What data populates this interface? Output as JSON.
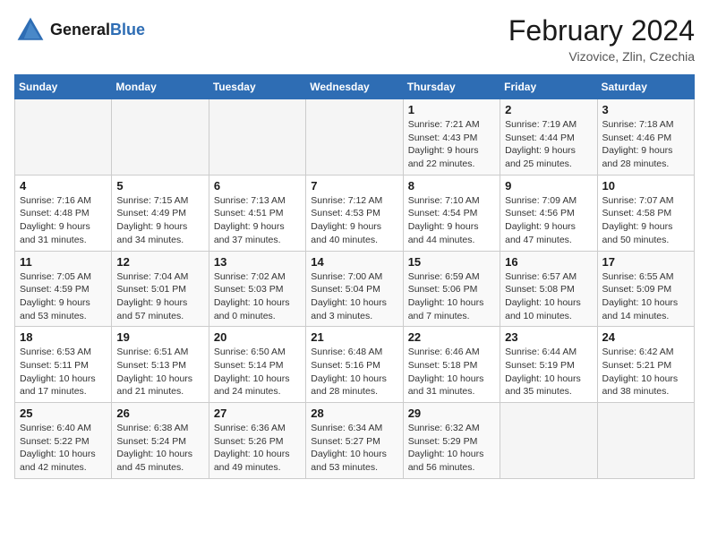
{
  "logo": {
    "text_general": "General",
    "text_blue": "Blue"
  },
  "title": {
    "month_year": "February 2024",
    "location": "Vizovice, Zlin, Czechia"
  },
  "weekdays": [
    "Sunday",
    "Monday",
    "Tuesday",
    "Wednesday",
    "Thursday",
    "Friday",
    "Saturday"
  ],
  "weeks": [
    [
      {
        "day": "",
        "info": ""
      },
      {
        "day": "",
        "info": ""
      },
      {
        "day": "",
        "info": ""
      },
      {
        "day": "",
        "info": ""
      },
      {
        "day": "1",
        "info": "Sunrise: 7:21 AM\nSunset: 4:43 PM\nDaylight: 9 hours\nand 22 minutes."
      },
      {
        "day": "2",
        "info": "Sunrise: 7:19 AM\nSunset: 4:44 PM\nDaylight: 9 hours\nand 25 minutes."
      },
      {
        "day": "3",
        "info": "Sunrise: 7:18 AM\nSunset: 4:46 PM\nDaylight: 9 hours\nand 28 minutes."
      }
    ],
    [
      {
        "day": "4",
        "info": "Sunrise: 7:16 AM\nSunset: 4:48 PM\nDaylight: 9 hours\nand 31 minutes."
      },
      {
        "day": "5",
        "info": "Sunrise: 7:15 AM\nSunset: 4:49 PM\nDaylight: 9 hours\nand 34 minutes."
      },
      {
        "day": "6",
        "info": "Sunrise: 7:13 AM\nSunset: 4:51 PM\nDaylight: 9 hours\nand 37 minutes."
      },
      {
        "day": "7",
        "info": "Sunrise: 7:12 AM\nSunset: 4:53 PM\nDaylight: 9 hours\nand 40 minutes."
      },
      {
        "day": "8",
        "info": "Sunrise: 7:10 AM\nSunset: 4:54 PM\nDaylight: 9 hours\nand 44 minutes."
      },
      {
        "day": "9",
        "info": "Sunrise: 7:09 AM\nSunset: 4:56 PM\nDaylight: 9 hours\nand 47 minutes."
      },
      {
        "day": "10",
        "info": "Sunrise: 7:07 AM\nSunset: 4:58 PM\nDaylight: 9 hours\nand 50 minutes."
      }
    ],
    [
      {
        "day": "11",
        "info": "Sunrise: 7:05 AM\nSunset: 4:59 PM\nDaylight: 9 hours\nand 53 minutes."
      },
      {
        "day": "12",
        "info": "Sunrise: 7:04 AM\nSunset: 5:01 PM\nDaylight: 9 hours\nand 57 minutes."
      },
      {
        "day": "13",
        "info": "Sunrise: 7:02 AM\nSunset: 5:03 PM\nDaylight: 10 hours\nand 0 minutes."
      },
      {
        "day": "14",
        "info": "Sunrise: 7:00 AM\nSunset: 5:04 PM\nDaylight: 10 hours\nand 3 minutes."
      },
      {
        "day": "15",
        "info": "Sunrise: 6:59 AM\nSunset: 5:06 PM\nDaylight: 10 hours\nand 7 minutes."
      },
      {
        "day": "16",
        "info": "Sunrise: 6:57 AM\nSunset: 5:08 PM\nDaylight: 10 hours\nand 10 minutes."
      },
      {
        "day": "17",
        "info": "Sunrise: 6:55 AM\nSunset: 5:09 PM\nDaylight: 10 hours\nand 14 minutes."
      }
    ],
    [
      {
        "day": "18",
        "info": "Sunrise: 6:53 AM\nSunset: 5:11 PM\nDaylight: 10 hours\nand 17 minutes."
      },
      {
        "day": "19",
        "info": "Sunrise: 6:51 AM\nSunset: 5:13 PM\nDaylight: 10 hours\nand 21 minutes."
      },
      {
        "day": "20",
        "info": "Sunrise: 6:50 AM\nSunset: 5:14 PM\nDaylight: 10 hours\nand 24 minutes."
      },
      {
        "day": "21",
        "info": "Sunrise: 6:48 AM\nSunset: 5:16 PM\nDaylight: 10 hours\nand 28 minutes."
      },
      {
        "day": "22",
        "info": "Sunrise: 6:46 AM\nSunset: 5:18 PM\nDaylight: 10 hours\nand 31 minutes."
      },
      {
        "day": "23",
        "info": "Sunrise: 6:44 AM\nSunset: 5:19 PM\nDaylight: 10 hours\nand 35 minutes."
      },
      {
        "day": "24",
        "info": "Sunrise: 6:42 AM\nSunset: 5:21 PM\nDaylight: 10 hours\nand 38 minutes."
      }
    ],
    [
      {
        "day": "25",
        "info": "Sunrise: 6:40 AM\nSunset: 5:22 PM\nDaylight: 10 hours\nand 42 minutes."
      },
      {
        "day": "26",
        "info": "Sunrise: 6:38 AM\nSunset: 5:24 PM\nDaylight: 10 hours\nand 45 minutes."
      },
      {
        "day": "27",
        "info": "Sunrise: 6:36 AM\nSunset: 5:26 PM\nDaylight: 10 hours\nand 49 minutes."
      },
      {
        "day": "28",
        "info": "Sunrise: 6:34 AM\nSunset: 5:27 PM\nDaylight: 10 hours\nand 53 minutes."
      },
      {
        "day": "29",
        "info": "Sunrise: 6:32 AM\nSunset: 5:29 PM\nDaylight: 10 hours\nand 56 minutes."
      },
      {
        "day": "",
        "info": ""
      },
      {
        "day": "",
        "info": ""
      }
    ]
  ]
}
